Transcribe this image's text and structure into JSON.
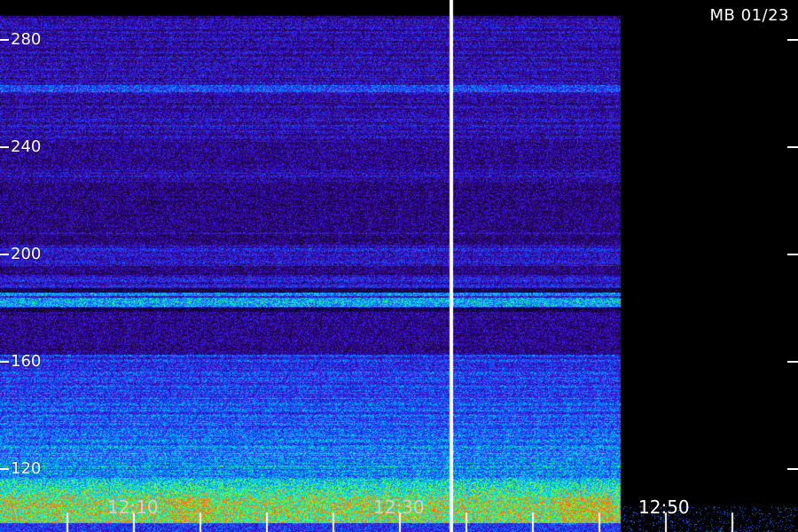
{
  "header": {
    "title": "MB 01/23"
  },
  "y_axis": {
    "ticks": [
      {
        "value": 280,
        "label": "280"
      },
      {
        "value": 240,
        "label": "240"
      },
      {
        "value": 200,
        "label": "200"
      },
      {
        "value": 160,
        "label": "160"
      },
      {
        "value": 120,
        "label": "120"
      }
    ],
    "range": [
      106,
      293
    ]
  },
  "x_axis": {
    "labels": [
      {
        "label": "12:10"
      },
      {
        "label": "12:30"
      },
      {
        "label": "12:50"
      }
    ]
  },
  "colors": {
    "background": "#000000",
    "low": "#1a0033",
    "mid": "#2b2bff",
    "cyan": "#00e5ff",
    "green": "#33ff33",
    "high": "#ff6600",
    "cursor_line": "#ffffff"
  }
}
